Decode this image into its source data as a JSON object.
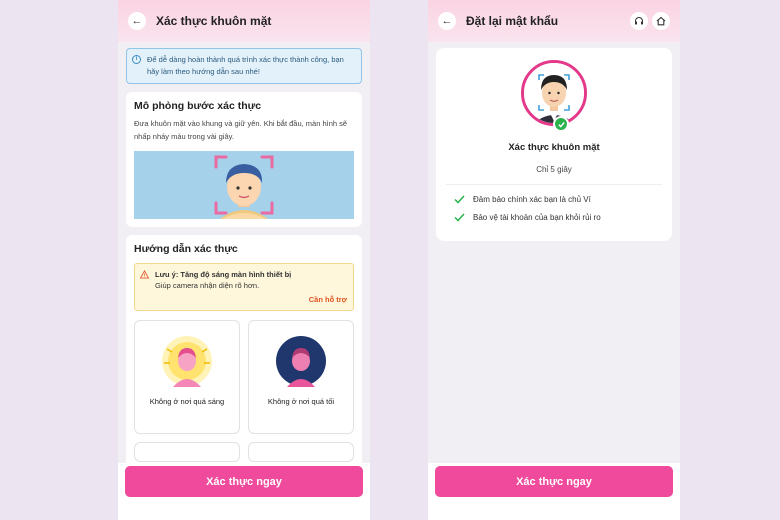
{
  "left": {
    "header": {
      "title": "Xác thực khuôn mặt"
    },
    "info": "Để dễ dàng hoàn thành quá trình xác thực thành công, bạn hãy làm theo hướng dẫn sau nhé!",
    "simulation": {
      "title": "Mô phỏng bước xác thực",
      "desc": "Đưa khuôn mặt vào khung và giữ yên. Khi bắt đầu, màn hình sẽ nhấp nháy màu trong vài giây."
    },
    "guide": {
      "title": "Hướng dẫn xác thực",
      "warning_title": "Lưu ý: Tăng độ sáng màn hình thiết bị",
      "warning_text": "Giúp camera nhận diện rõ hơn.",
      "help_link": "Cần hỗ trợ",
      "tiles": [
        {
          "label": "Không ở nơi quá sáng"
        },
        {
          "label": "Không ở nơi quá tối"
        }
      ]
    },
    "button": "Xác thực ngay"
  },
  "right": {
    "header": {
      "title": "Đặt lại mật khẩu"
    },
    "card": {
      "title": "Xác thực khuôn mặt",
      "subtitle": "Chỉ 5 giây",
      "benefits": [
        "Đảm bảo chính xác bạn là chủ Ví",
        "Bảo vệ tài khoản của bạn khỏi rủi ro"
      ]
    },
    "button": "Xác thực ngay"
  },
  "icons": {
    "back": "back-arrow-icon",
    "support": "headset-icon",
    "home": "home-icon",
    "info": "info-icon",
    "warning": "warning-icon",
    "check": "check-icon"
  },
  "colors": {
    "primary": "#ef4a9b",
    "header": "#fbd3e3",
    "info_border": "#8fc6e8",
    "warning_bg": "#fff7dc",
    "success": "#2bb24c",
    "help_link": "#e0541f"
  }
}
